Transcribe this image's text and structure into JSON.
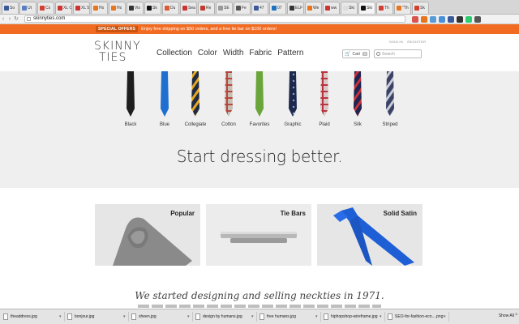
{
  "browser": {
    "tabs": [
      {
        "label": "So",
        "color": "#3b5998"
      },
      {
        "label": "Ut",
        "color": "#5b7dc2"
      },
      {
        "label": "Co",
        "color": "#d23f31"
      },
      {
        "label": "XL Co",
        "color": "#cc3333"
      },
      {
        "label": "XL 5 L",
        "color": "#cc3333"
      },
      {
        "label": "Ho",
        "color": "#e8741c"
      },
      {
        "label": "Ho",
        "color": "#e8741c"
      },
      {
        "label": "Vis",
        "color": "#333333"
      },
      {
        "label": "Sk",
        "color": "#111111"
      },
      {
        "label": "Du",
        "color": "#de5833"
      },
      {
        "label": "Sea",
        "color": "#cc3333"
      },
      {
        "label": "Re",
        "color": "#c0392b"
      },
      {
        "label": "SE",
        "color": "#999999"
      },
      {
        "label": "Fe",
        "color": "#555555"
      },
      {
        "label": "47",
        "color": "#3b5998"
      },
      {
        "label": "07",
        "color": "#1e73be"
      },
      {
        "label": "ELF",
        "color": "#333333"
      },
      {
        "label": "We",
        "color": "#e8741c"
      },
      {
        "label": "ww",
        "color": "#cc3333"
      },
      {
        "label": "Ski",
        "color": "#dddddd"
      },
      {
        "label": "Ski",
        "color": "#111111"
      },
      {
        "label": "Th",
        "color": "#d23f31"
      },
      {
        "label": "\"Th",
        "color": "#e8741c"
      },
      {
        "label": "Sk",
        "color": "#d23f31"
      }
    ],
    "url": "skinnyties.com",
    "ext_colors": [
      "#d9534f",
      "#e8741c",
      "#5b9bd5",
      "#4a90d9",
      "#3b5998",
      "#333333",
      "#2ecc71",
      "#555555"
    ]
  },
  "promo": {
    "badge": "SPECIAL OFFERS",
    "text": "Enjoy free shipping on $50 orders, and a free tie bar on $100 orders!"
  },
  "header": {
    "logo_line1": "SKINNY",
    "logo_line2": "TIES",
    "nav": [
      "Collection",
      "Color",
      "Width",
      "Fabric",
      "Pattern"
    ],
    "sign_in": "SIGN IN",
    "register": "REGISTER",
    "cart_label": "Cart",
    "cart_count": "0",
    "search_placeholder": "Search"
  },
  "ties": [
    {
      "label": "Black",
      "base": "#1e1e1e",
      "stripe": "#1e1e1e",
      "pattern": "solid"
    },
    {
      "label": "Blue",
      "base": "#1f6fd1",
      "stripe": "#1f6fd1",
      "pattern": "solid"
    },
    {
      "label": "Collegiate",
      "base": "#1f2a44",
      "stripe": "#e8a81c",
      "pattern": "stripe"
    },
    {
      "label": "Cotton",
      "base": "#c7c0b5",
      "stripe": "#b5473d",
      "pattern": "plaid"
    },
    {
      "label": "Favorites",
      "base": "#6aa53a",
      "stripe": "#6aa53a",
      "pattern": "solid"
    },
    {
      "label": "Graphic",
      "base": "#1d2a4d",
      "stripe": "#8fa6c9",
      "pattern": "dots"
    },
    {
      "label": "Plaid",
      "base": "#d8c8c8",
      "stripe": "#b8333d",
      "pattern": "plaid"
    },
    {
      "label": "Silk",
      "base": "#1d2550",
      "stripe": "#c9303c",
      "pattern": "stripe"
    },
    {
      "label": "Striped",
      "base": "#3c4266",
      "stripe": "#c9cdd8",
      "pattern": "stripe"
    }
  ],
  "headline": "Start dressing better.",
  "cards": [
    {
      "title": "Popular"
    },
    {
      "title": "Tie Bars"
    },
    {
      "title": "Solid Satin"
    }
  ],
  "tagline": "We started designing and selling neckties in 1971.",
  "downloads": [
    {
      "name": "theaddress.jpg"
    },
    {
      "name": "bonjour.jpg"
    },
    {
      "name": "sheen.jpg"
    },
    {
      "name": "design by humans.jpg"
    },
    {
      "name": "free humans.jpg"
    },
    {
      "name": "hiphopshop-wireframe.jpg"
    },
    {
      "name": "SEO-for-fashion-eco....png"
    }
  ],
  "show_all": "Show All"
}
